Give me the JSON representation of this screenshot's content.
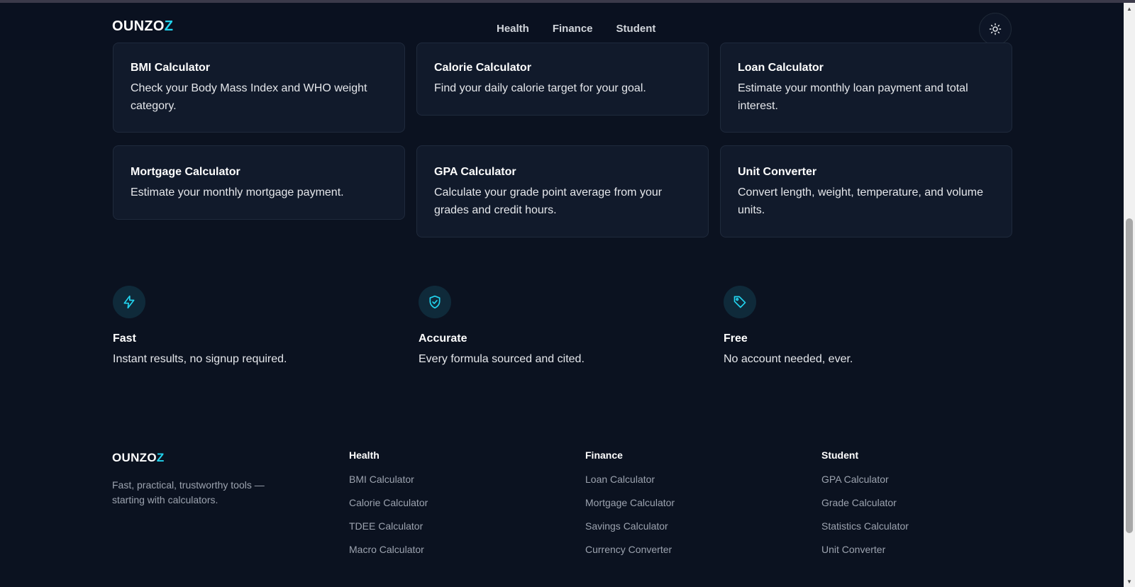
{
  "brand": {
    "name_main": "OUNZO",
    "name_accent": "Z",
    "accent_color": "#22d3ee"
  },
  "nav": [
    {
      "label": "Health"
    },
    {
      "label": "Finance"
    },
    {
      "label": "Student"
    }
  ],
  "theme_toggle": {
    "icon": "sun-icon"
  },
  "tools": [
    {
      "title": "BMI Calculator",
      "description": "Check your Body Mass Index and WHO weight category."
    },
    {
      "title": "Calorie Calculator",
      "description": "Find your daily calorie target for your goal."
    },
    {
      "title": "Loan Calculator",
      "description": "Estimate your monthly loan payment and total interest."
    },
    {
      "title": "Mortgage Calculator",
      "description": "Estimate your monthly mortgage payment."
    },
    {
      "title": "GPA Calculator",
      "description": "Calculate your grade point average from your grades and credit hours."
    },
    {
      "title": "Unit Converter",
      "description": "Convert length, weight, temperature, and volume units."
    }
  ],
  "features": [
    {
      "icon": "lightning-icon",
      "title": "Fast",
      "description": "Instant results, no signup required."
    },
    {
      "icon": "shield-check-icon",
      "title": "Accurate",
      "description": "Every formula sourced and cited."
    },
    {
      "icon": "tag-icon",
      "title": "Free",
      "description": "No account needed, ever."
    }
  ],
  "footer": {
    "tagline": "Fast, practical, trustworthy tools — starting with calculators.",
    "columns": [
      {
        "heading": "Health",
        "links": [
          "BMI Calculator",
          "Calorie Calculator",
          "TDEE Calculator",
          "Macro Calculator"
        ]
      },
      {
        "heading": "Finance",
        "links": [
          "Loan Calculator",
          "Mortgage Calculator",
          "Savings Calculator",
          "Currency Converter"
        ]
      },
      {
        "heading": "Student",
        "links": [
          "GPA Calculator",
          "Grade Calculator",
          "Statistics Calculator",
          "Unit Converter"
        ]
      }
    ]
  },
  "colors": {
    "background": "#0b1220",
    "card": "#111a2b",
    "accent": "#22d3ee",
    "muted_text": "#9ca3af"
  }
}
